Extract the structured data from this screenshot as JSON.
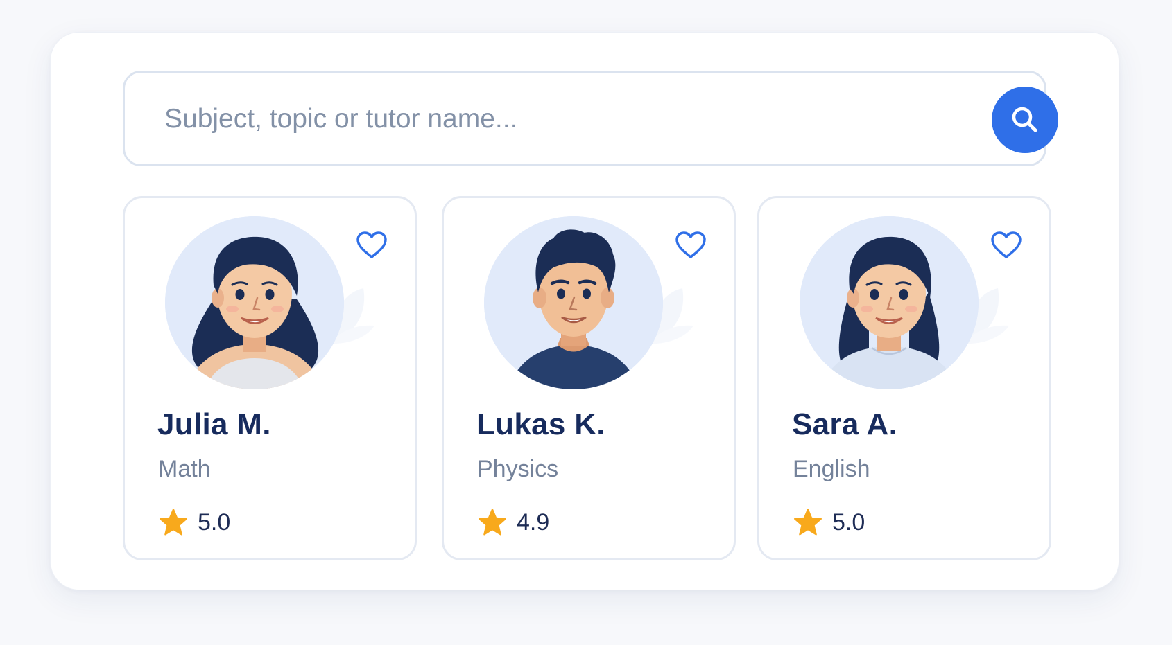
{
  "search": {
    "placeholder": "Subject, topic or tutor name...",
    "value": "",
    "button_icon": "search-icon"
  },
  "tutors": [
    {
      "name": "Julia M.",
      "subject": "Math",
      "rating": "5.0",
      "favorite_icon": "heart-outline-icon",
      "rating_icon": "star-icon"
    },
    {
      "name": "Lukas K.",
      "subject": "Physics",
      "rating": "4.9",
      "favorite_icon": "heart-outline-icon",
      "rating_icon": "star-icon"
    },
    {
      "name": "Sara A.",
      "subject": "English",
      "rating": "5.0",
      "favorite_icon": "heart-outline-icon",
      "rating_icon": "star-icon"
    }
  ],
  "colors": {
    "accent": "#2f6fe8",
    "name_text": "#172b5d",
    "muted_text": "#74829a",
    "star": "#f8a91c",
    "card_border": "#e4e9f2",
    "avatar_bg": "#e1eafa"
  }
}
